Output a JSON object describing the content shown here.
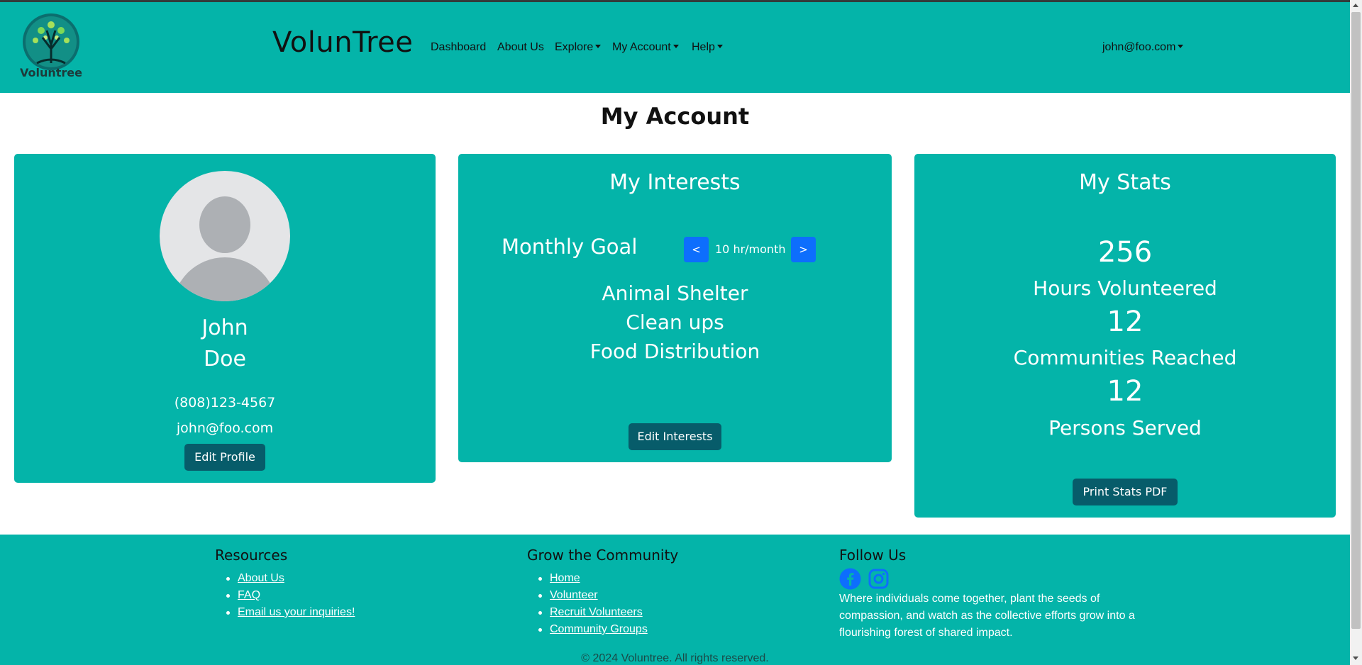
{
  "brand": {
    "name": "VolunTree",
    "logo_text": "Voluntree"
  },
  "nav": {
    "items": [
      {
        "label": "Dashboard",
        "dropdown": false
      },
      {
        "label": "About Us",
        "dropdown": false
      },
      {
        "label": "Explore",
        "dropdown": true
      },
      {
        "label": "My Account",
        "dropdown": true
      },
      {
        "label": "Help",
        "dropdown": true
      }
    ],
    "user": "john@foo.com"
  },
  "page": {
    "title": "My Account"
  },
  "profile": {
    "first_name": "John",
    "last_name": "Doe",
    "phone": "(808)123-4567",
    "email": "john@foo.com",
    "edit_label": "Edit Profile"
  },
  "interests": {
    "title": "My Interests",
    "goal_label": "Monthly Goal",
    "goal_value": "10 hr/month",
    "prev_label": "<",
    "next_label": ">",
    "items": [
      "Animal Shelter",
      "Clean ups",
      "Food Distribution"
    ],
    "edit_label": "Edit Interests"
  },
  "stats": {
    "title": "My Stats",
    "hours_value": "256",
    "hours_label": "Hours Volunteered",
    "communities_value": "12",
    "communities_label": "Communities Reached",
    "persons_value": "12",
    "persons_label": "Persons Served",
    "print_label": "Print Stats PDF"
  },
  "footer": {
    "resources": {
      "heading": "Resources",
      "links": [
        "About Us",
        "FAQ",
        "Email us your inquiries!"
      ]
    },
    "community": {
      "heading": "Grow the Community",
      "links": [
        "Home",
        "Volunteer",
        "Recruit Volunteers",
        "Community Groups"
      ]
    },
    "follow": {
      "heading": "Follow Us",
      "icons": [
        "facebook-icon",
        "instagram-icon"
      ],
      "tagline": "Where individuals come together, plant the seeds of compassion, and watch as the collective efforts grow into a flourishing forest of shared impact."
    },
    "copyright": "© 2024 Voluntree. All rights reserved."
  },
  "colors": {
    "teal": "#04b4a9",
    "dark_button": "#075c6a",
    "blue_button": "#0d6efd",
    "social_blue": "#0d6efd"
  }
}
